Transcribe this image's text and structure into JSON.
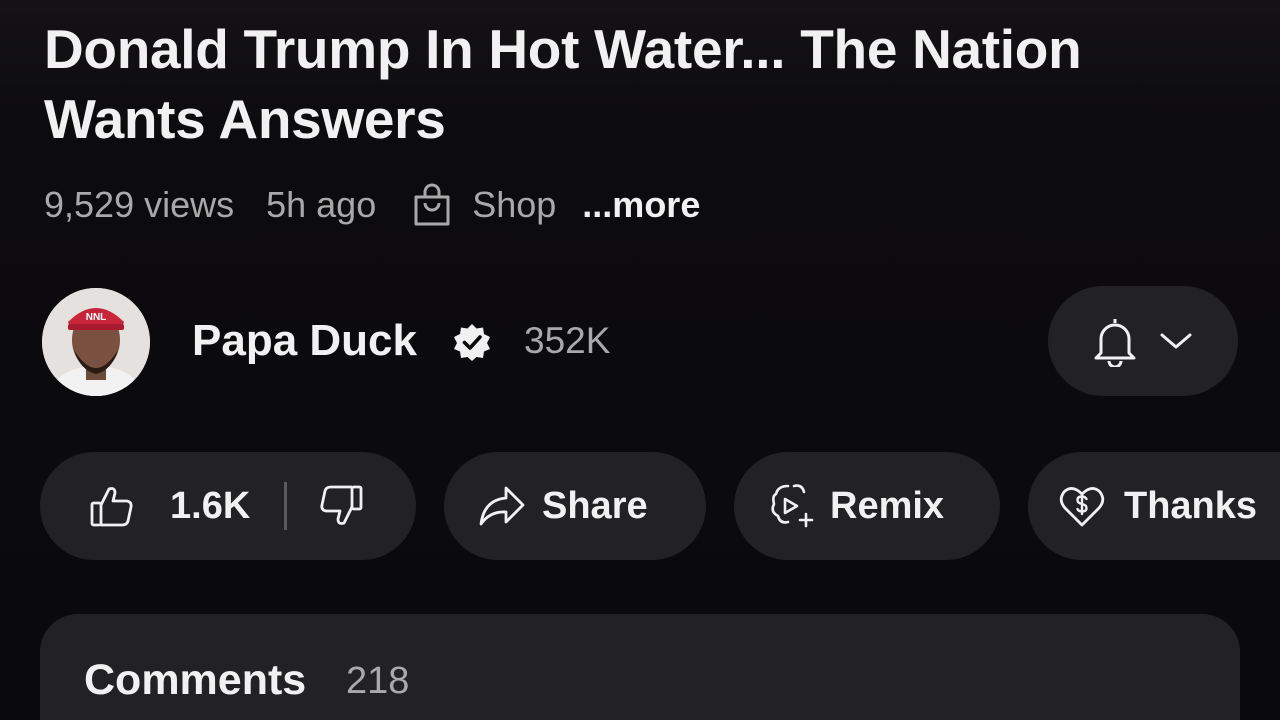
{
  "video": {
    "title": "Donald Trump In Hot Water... The Nation Wants Answers",
    "views": "9,529 views",
    "age": "5h ago",
    "shop_label": "Shop",
    "more_label": "...more"
  },
  "channel": {
    "name": "Papa Duck",
    "subscribers": "352K",
    "verified_icon": "verified-badge-icon",
    "avatar_cap_text": "NNL"
  },
  "actions": {
    "likes": "1.6K",
    "share_label": "Share",
    "remix_label": "Remix",
    "thanks_label": "Thanks"
  },
  "comments": {
    "title": "Comments",
    "count": "218"
  },
  "colors": {
    "background": "#0b0a0c",
    "pill": "#222124",
    "text_primary": "#f1f1f1",
    "text_secondary": "#a9a9a9"
  }
}
